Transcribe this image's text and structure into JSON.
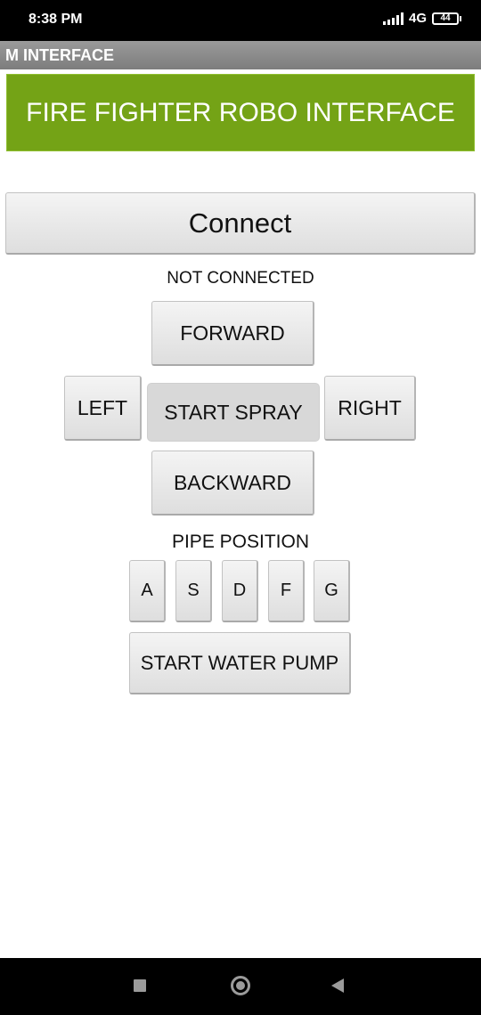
{
  "status_bar": {
    "time": "8:38 PM",
    "network": "4G",
    "battery": "44"
  },
  "app": {
    "title": "M INTERFACE",
    "banner": "FIRE FIGHTER ROBO INTERFACE"
  },
  "connection": {
    "connect_label": "Connect",
    "status_text": "NOT CONNECTED"
  },
  "controls": {
    "forward": "FORWARD",
    "left": "LEFT",
    "start_spray": "START SPRAY",
    "right": "RIGHT",
    "backward": "BACKWARD"
  },
  "pipe": {
    "label": "PIPE POSITION",
    "buttons": [
      "A",
      "S",
      "D",
      "F",
      "G"
    ]
  },
  "pump": {
    "label": "START WATER PUMP"
  },
  "nav_icons": [
    "recent-apps-icon",
    "home-icon",
    "back-icon"
  ],
  "colors": {
    "banner": "#74a316",
    "title_bar": "#8a8a8a"
  }
}
